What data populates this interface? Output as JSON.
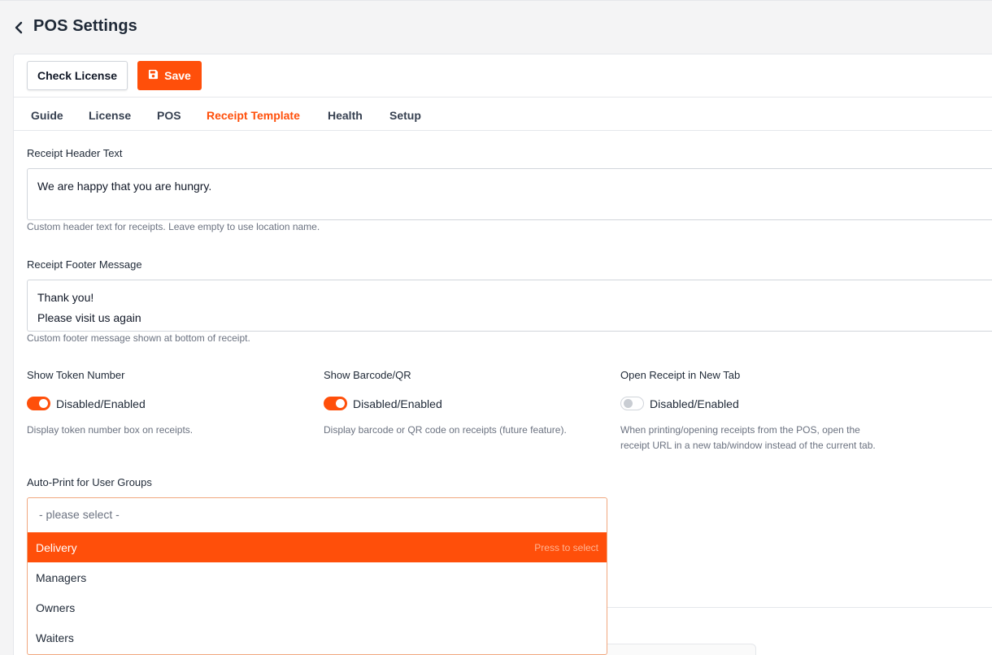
{
  "header": {
    "title": "POS Settings"
  },
  "toolbar": {
    "check_license_label": "Check License",
    "save_label": "Save"
  },
  "tabs": [
    {
      "label": "Guide"
    },
    {
      "label": "License"
    },
    {
      "label": "POS"
    },
    {
      "label": "Receipt Template",
      "active": true
    },
    {
      "label": "Health"
    },
    {
      "label": "Setup"
    }
  ],
  "receipt_header": {
    "label": "Receipt Header Text",
    "value": "We are happy that you are hungry.",
    "help": "Custom header text for receipts. Leave empty to use location name."
  },
  "receipt_footer": {
    "label": "Receipt Footer Message",
    "lines": [
      "Thank you!",
      "Please visit us again"
    ],
    "help": "Custom footer message shown at bottom of receipt."
  },
  "toggles": [
    {
      "label": "Show Token Number",
      "text": "Disabled/Enabled",
      "enabled": true,
      "help": "Display token number box on receipts."
    },
    {
      "label": "Show Barcode/QR",
      "text": "Disabled/Enabled",
      "enabled": true,
      "help": "Display barcode or QR code on receipts (future feature)."
    },
    {
      "label": "Open Receipt in New Tab",
      "text": "Disabled/Enabled",
      "enabled": false,
      "help_lines": [
        "When printing/opening receipts from the POS, open the",
        "receipt URL in a new tab/window instead of the current tab."
      ]
    }
  ],
  "auto_print": {
    "label": "Auto-Print for User Groups",
    "placeholder": "- please select -",
    "options": [
      {
        "label": "Delivery",
        "highlighted": true,
        "hint": "Press to select"
      },
      {
        "label": "Managers"
      },
      {
        "label": "Owners"
      },
      {
        "label": "Waiters"
      }
    ]
  },
  "colors": {
    "accent": "#ff4f0a",
    "text": "#1f2937",
    "muted": "#6b7280",
    "border": "#d1d5db"
  }
}
